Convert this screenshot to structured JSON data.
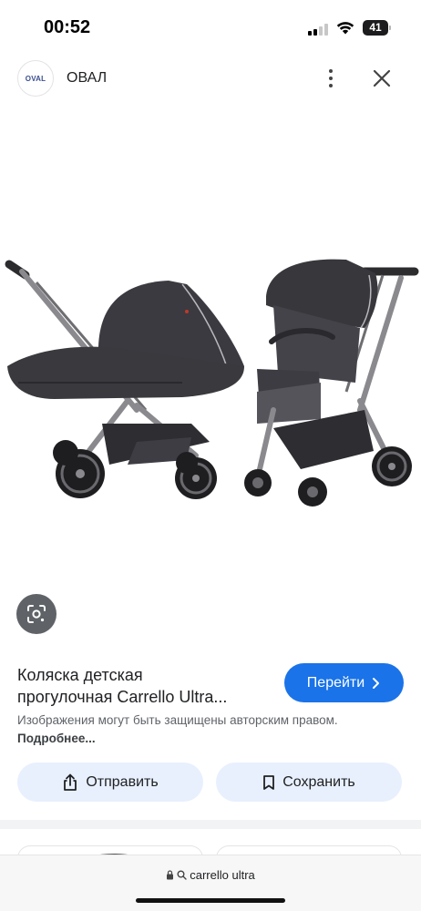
{
  "status_bar": {
    "time": "00:52",
    "battery_level": "41"
  },
  "header": {
    "site_logo_text": "OVAL",
    "site_name": "ОВАЛ",
    "more_icon": "more-vertical-icon",
    "close_icon": "close-icon"
  },
  "image": {
    "description_icon": "stroller-product-image"
  },
  "lens": {
    "icon": "lens-camera-icon"
  },
  "result": {
    "title_line1": "Коляска детская",
    "title_line2": "прогулочная Carrello Ultra...",
    "visit_label": "Перейти",
    "copyright_text": "Изображения могут быть защищены авторским правом.",
    "copyright_more": "Подробнее..."
  },
  "actions": {
    "share_label": "Отправить",
    "save_label": "Сохранить"
  },
  "url_bar": {
    "query": "carrello ultra"
  },
  "colors": {
    "accent": "#1a73e8",
    "action_bg": "#e8f0fe",
    "lens_bg": "#5f6368"
  }
}
